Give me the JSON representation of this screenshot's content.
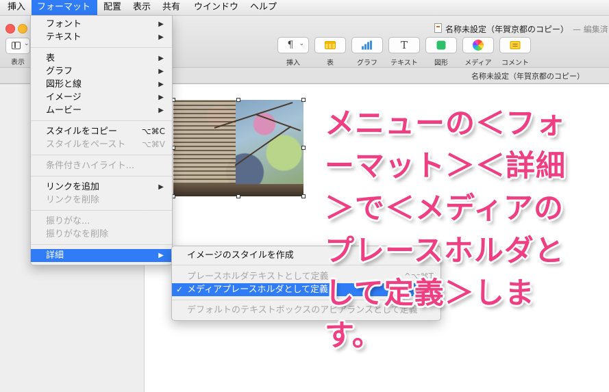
{
  "menubar": {
    "items": [
      "挿入",
      "フォーマット",
      "配置",
      "表示",
      "共有",
      "ウインドウ",
      "ヘルプ"
    ],
    "active_index": 1
  },
  "window": {
    "doc_title": "名称未設定（年賀京都のコピー）",
    "doc_status": "— 編集済",
    "tab_title": "名称未設定（年賀京都のコピー）",
    "view_label": "表示"
  },
  "toolbar": {
    "items": [
      {
        "label": "挿入",
        "icon": "paragraph-icon"
      },
      {
        "label": "表",
        "icon": "table-icon"
      },
      {
        "label": "グラフ",
        "icon": "chart-icon"
      },
      {
        "label": "テキスト",
        "icon": "text-icon"
      },
      {
        "label": "図形",
        "icon": "shape-icon"
      },
      {
        "label": "メディア",
        "icon": "media-icon"
      },
      {
        "label": "コメント",
        "icon": "comment-icon"
      }
    ]
  },
  "format_menu": {
    "font": "フォント",
    "text": "テキスト",
    "table": "表",
    "chart": "グラフ",
    "shape_line": "図形と線",
    "image": "イメージ",
    "movie": "ムービー",
    "copy_style": "スタイルをコピー",
    "copy_style_shortcut": "⌥⌘C",
    "paste_style": "スタイルをペースト",
    "paste_style_shortcut": "⌥⌘V",
    "conditional_highlight": "条件付きハイライト...",
    "add_link": "リンクを追加",
    "remove_link": "リンクを削除",
    "ruby": "振りがな...",
    "remove_ruby": "振りがなを削除",
    "advanced": "詳細"
  },
  "advanced_submenu": {
    "create_image_style": "イメージのスタイルを作成",
    "define_text_placeholder": "プレースホルダテキストとして定義",
    "define_text_placeholder_shortcut": "^⌥⌘T",
    "define_media_placeholder": "メディアプレースホルダとして定義",
    "define_media_placeholder_shortcut": "^⌥⌘I",
    "checkmark": "✓",
    "define_default_textbox": "デフォルトのテキストボックスのアピアランスとして定義"
  },
  "annotation": {
    "lines": [
      "メニューの＜フォ",
      "ーマット＞＜詳細",
      "＞で＜メディアの",
      "プレースホルダと",
      "して定義＞しま",
      "す。"
    ]
  },
  "colors": {
    "accent": "#2f7cf6",
    "annotation": "#ef3f83"
  }
}
